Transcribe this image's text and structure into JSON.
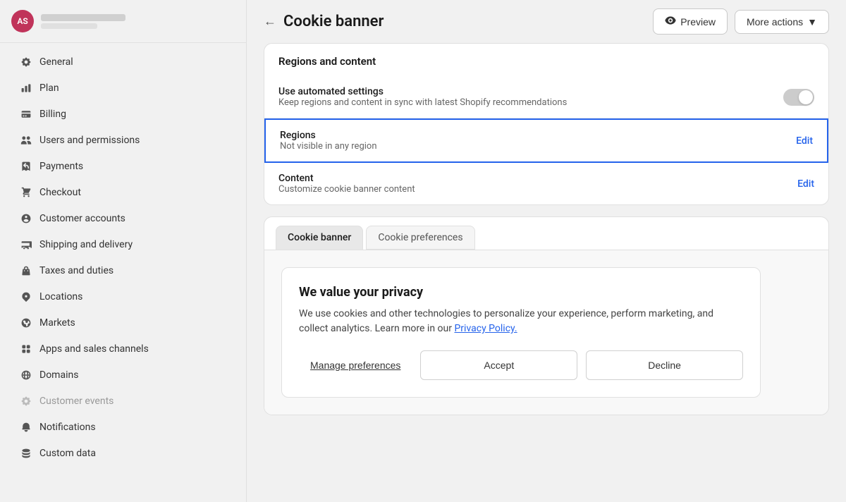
{
  "sidebar": {
    "avatar": "AS",
    "store": {
      "name_blur": true,
      "sub_blur": true
    },
    "items": [
      {
        "id": "general",
        "label": "General",
        "icon": "general"
      },
      {
        "id": "plan",
        "label": "Plan",
        "icon": "plan"
      },
      {
        "id": "billing",
        "label": "Billing",
        "icon": "billing"
      },
      {
        "id": "users",
        "label": "Users and permissions",
        "icon": "users"
      },
      {
        "id": "payments",
        "label": "Payments",
        "icon": "payments"
      },
      {
        "id": "checkout",
        "label": "Checkout",
        "icon": "checkout"
      },
      {
        "id": "customer-accounts",
        "label": "Customer accounts",
        "icon": "customer-accounts"
      },
      {
        "id": "shipping",
        "label": "Shipping and delivery",
        "icon": "shipping"
      },
      {
        "id": "taxes",
        "label": "Taxes and duties",
        "icon": "taxes"
      },
      {
        "id": "locations",
        "label": "Locations",
        "icon": "locations"
      },
      {
        "id": "markets",
        "label": "Markets",
        "icon": "markets"
      },
      {
        "id": "apps",
        "label": "Apps and sales channels",
        "icon": "apps"
      },
      {
        "id": "domains",
        "label": "Domains",
        "icon": "domains"
      },
      {
        "id": "customer-events",
        "label": "Customer events",
        "icon": "customer-events",
        "disabled": true
      },
      {
        "id": "notifications",
        "label": "Notifications",
        "icon": "notifications"
      },
      {
        "id": "custom-data",
        "label": "Custom data",
        "icon": "custom-data"
      }
    ]
  },
  "topbar": {
    "title": "Cookie banner",
    "preview_label": "Preview",
    "more_actions_label": "More actions"
  },
  "regions_content": {
    "section_title": "Regions and content",
    "automated_title": "Use automated settings",
    "automated_subtitle": "Keep regions and content in sync with latest Shopify recommendations",
    "regions_title": "Regions",
    "regions_subtitle": "Not visible in any region",
    "regions_edit": "Edit",
    "content_title": "Content",
    "content_subtitle": "Customize cookie banner content",
    "content_edit": "Edit"
  },
  "cookie_preview": {
    "tab_banner": "Cookie banner",
    "tab_preferences": "Cookie preferences",
    "banner_title": "We value your privacy",
    "banner_text": "We use cookies and other technologies to personalize your experience, perform marketing, and collect analytics. Learn more in our",
    "banner_link": "Privacy Policy.",
    "btn_manage": "Manage preferences",
    "btn_accept": "Accept",
    "btn_decline": "Decline"
  }
}
